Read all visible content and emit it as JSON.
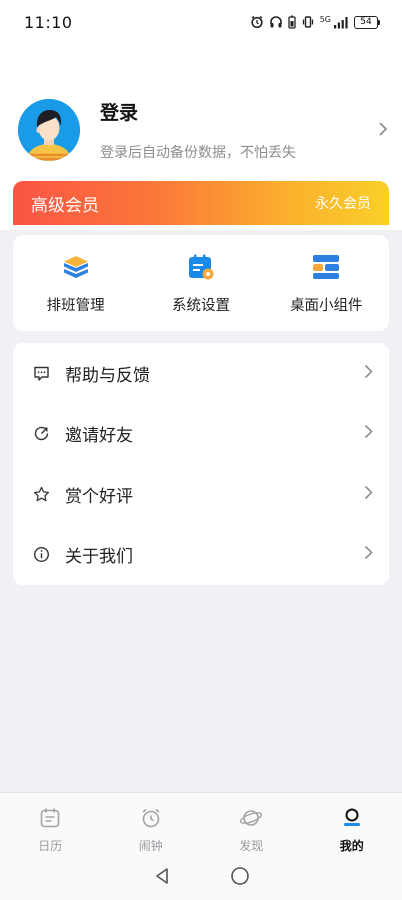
{
  "status_bar": {
    "time": "11:10",
    "battery": "54",
    "network": "5G"
  },
  "profile": {
    "title": "登录",
    "subtitle": "登录后自动备份数据，不怕丢失"
  },
  "vip": {
    "title": "高级会员",
    "right_label": "永久会员"
  },
  "quick_actions": [
    {
      "label": "排班管理",
      "icon": "layers-icon"
    },
    {
      "label": "系统设置",
      "icon": "calendar-settings-icon"
    },
    {
      "label": "桌面小组件",
      "icon": "widget-icon"
    }
  ],
  "menu": [
    {
      "label": "帮助与反馈",
      "icon": "chat-icon"
    },
    {
      "label": "邀请好友",
      "icon": "share-icon"
    },
    {
      "label": "赏个好评",
      "icon": "star-icon"
    },
    {
      "label": "关于我们",
      "icon": "info-icon"
    }
  ],
  "bottom_nav": [
    {
      "label": "日历",
      "icon": "calendar-icon",
      "active": false
    },
    {
      "label": "闹钟",
      "icon": "alarm-icon",
      "active": false
    },
    {
      "label": "发现",
      "icon": "planet-icon",
      "active": false
    },
    {
      "label": "我的",
      "icon": "user-icon",
      "active": true
    }
  ],
  "colors": {
    "accent_blue": "#1a8ae8",
    "vip_gradient_start": "#fb5444",
    "vip_gradient_end": "#f9cf2a"
  }
}
